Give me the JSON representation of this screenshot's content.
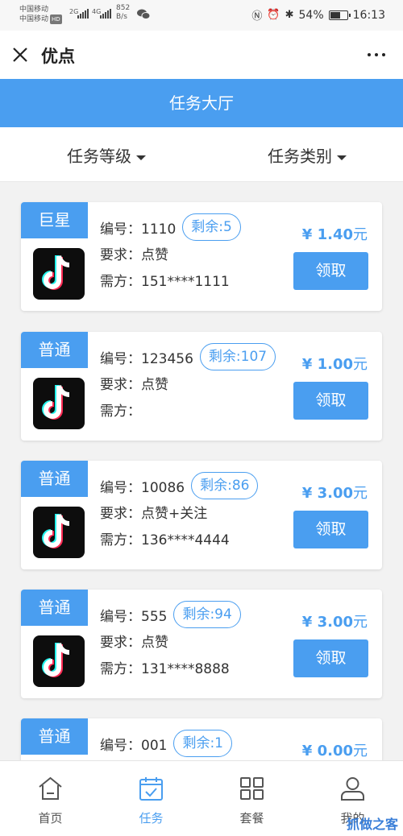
{
  "status_bar": {
    "carrier1": "中国移动",
    "carrier2": "中国移动",
    "hd": "HD",
    "net1": "2G",
    "net2": "4G",
    "speed": "852",
    "speed_unit": "B/s",
    "battery": "54%",
    "time": "16:13"
  },
  "nav": {
    "title": "优点"
  },
  "header": {
    "title": "任务大厅"
  },
  "filters": {
    "level": "任务等级",
    "type": "任务类别"
  },
  "tasks": [
    {
      "tag": "巨星",
      "id_label": "编号：",
      "id": "1110",
      "remain": "剩余:5",
      "req_label": "要求：",
      "req": "点赞",
      "buyer_label": "需方：",
      "buyer": "151****1111",
      "price": "¥ 1.40",
      "unit": "元",
      "button": "领取"
    },
    {
      "tag": "普通",
      "id_label": "编号：",
      "id": "123456",
      "remain": "剩余:107",
      "req_label": "要求：",
      "req": "点赞",
      "buyer_label": "需方：",
      "buyer": "",
      "price": "¥ 1.00",
      "unit": "元",
      "button": "领取"
    },
    {
      "tag": "普通",
      "id_label": "编号：",
      "id": "10086",
      "remain": "剩余:86",
      "req_label": "要求：",
      "req": "点赞+关注",
      "buyer_label": "需方：",
      "buyer": "136****4444",
      "price": "¥ 3.00",
      "unit": "元",
      "button": "领取"
    },
    {
      "tag": "普通",
      "id_label": "编号：",
      "id": "555",
      "remain": "剩余:94",
      "req_label": "要求：",
      "req": "点赞",
      "buyer_label": "需方：",
      "buyer": "131****8888",
      "price": "¥ 3.00",
      "unit": "元",
      "button": "领取"
    },
    {
      "tag": "普通",
      "id_label": "编号：",
      "id": "001",
      "remain": "剩余:1",
      "price": "¥ 0.00",
      "unit": "元"
    }
  ],
  "tabbar": {
    "home": "首页",
    "task": "任务",
    "package": "套餐",
    "mine": "我的"
  },
  "watermark": "抓做之客",
  "colors": {
    "accent": "#4a9ef0"
  }
}
